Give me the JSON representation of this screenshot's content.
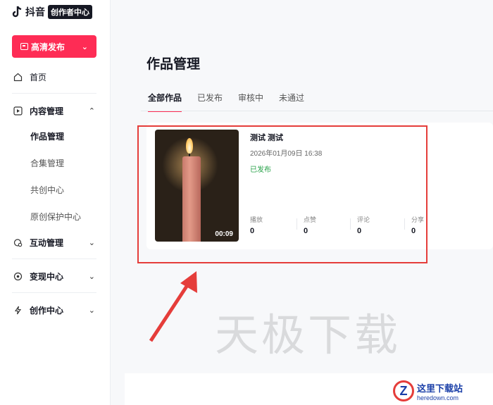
{
  "logo": {
    "name": "抖音",
    "badge": "创作者中心"
  },
  "publish_button": {
    "label": "高清发布"
  },
  "nav": {
    "home": "首页",
    "content": "内容管理",
    "content_sub": [
      "作品管理",
      "合集管理",
      "共创中心",
      "原创保护中心"
    ],
    "interaction": "互动管理",
    "monetize": "变现中心",
    "creation": "创作中心"
  },
  "main": {
    "title": "作品管理",
    "tabs": [
      "全部作品",
      "已发布",
      "审核中",
      "未通过"
    ]
  },
  "work": {
    "duration": "00:09",
    "title": "测试 测试",
    "time": "2026年01月09日 16:38",
    "status": "已发布",
    "stats": [
      {
        "label": "播放",
        "value": "0"
      },
      {
        "label": "点赞",
        "value": "0"
      },
      {
        "label": "评论",
        "value": "0"
      },
      {
        "label": "分享",
        "value": "0"
      }
    ]
  },
  "watermark": "天极下载",
  "site_logo": {
    "mark": "Z",
    "cn": "这里下载站",
    "en": "heredown.com"
  },
  "colors": {
    "accent": "#fe2c55",
    "highlight": "#e53d3a",
    "published": "#2aa34a"
  }
}
